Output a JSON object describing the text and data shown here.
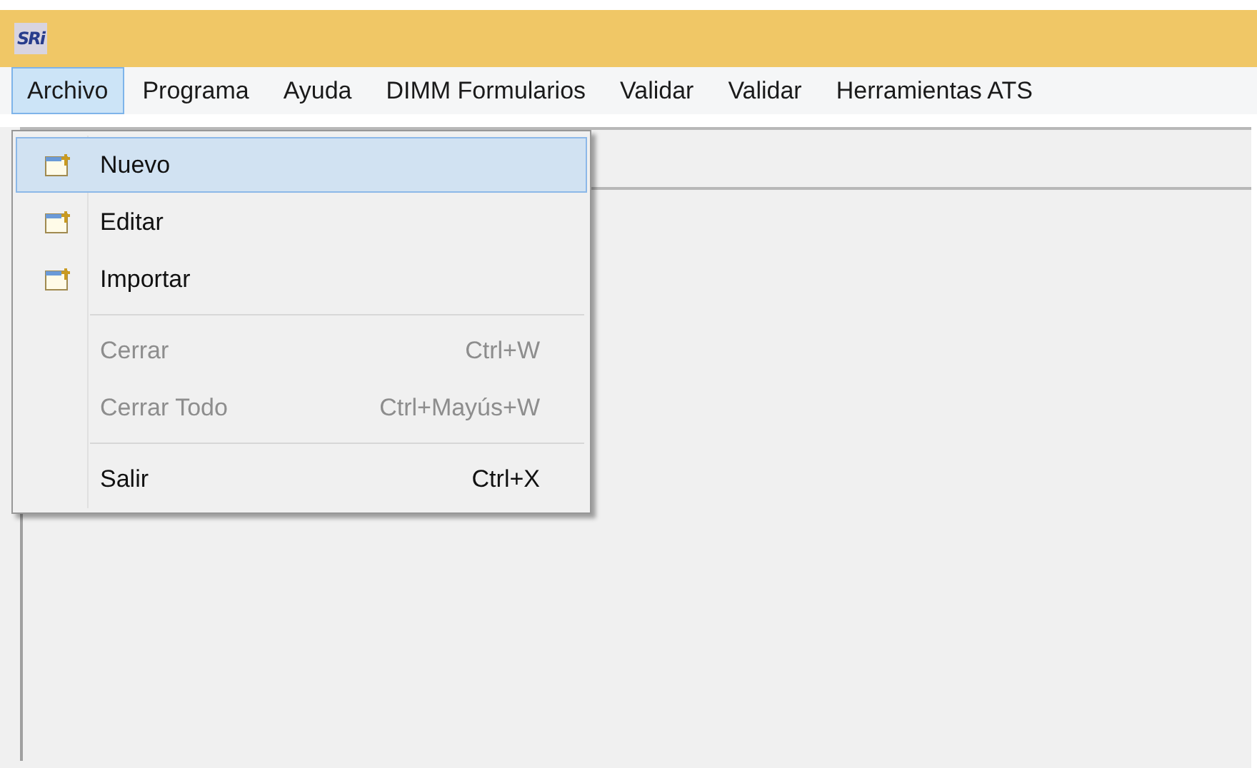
{
  "app_logo": "SRi",
  "menu_bar": [
    {
      "label": "Archivo",
      "selected": true
    },
    {
      "label": "Programa",
      "selected": false
    },
    {
      "label": "Ayuda",
      "selected": false
    },
    {
      "label": "DIMM Formularios",
      "selected": false
    },
    {
      "label": "Validar",
      "selected": false
    },
    {
      "label": "Validar",
      "selected": false
    },
    {
      "label": "Herramientas ATS",
      "selected": false
    }
  ],
  "dropdown_menu": [
    {
      "kind": "item",
      "label": "Nuevo",
      "icon": true,
      "selected": true,
      "disabled": false
    },
    {
      "kind": "item",
      "label": "Editar",
      "icon": true,
      "selected": false,
      "disabled": false
    },
    {
      "kind": "item",
      "label": "Importar",
      "icon": true,
      "selected": false,
      "disabled": false
    },
    {
      "kind": "separator"
    },
    {
      "kind": "item",
      "label": "Cerrar",
      "shortcut": "Ctrl+W",
      "icon": false,
      "selected": false,
      "disabled": true
    },
    {
      "kind": "item",
      "label": "Cerrar Todo",
      "shortcut": "Ctrl+Mayús+W",
      "icon": false,
      "selected": false,
      "disabled": true
    },
    {
      "kind": "separator"
    },
    {
      "kind": "item",
      "label": "Salir",
      "shortcut": "Ctrl+X",
      "icon": false,
      "selected": false,
      "disabled": false
    }
  ]
}
